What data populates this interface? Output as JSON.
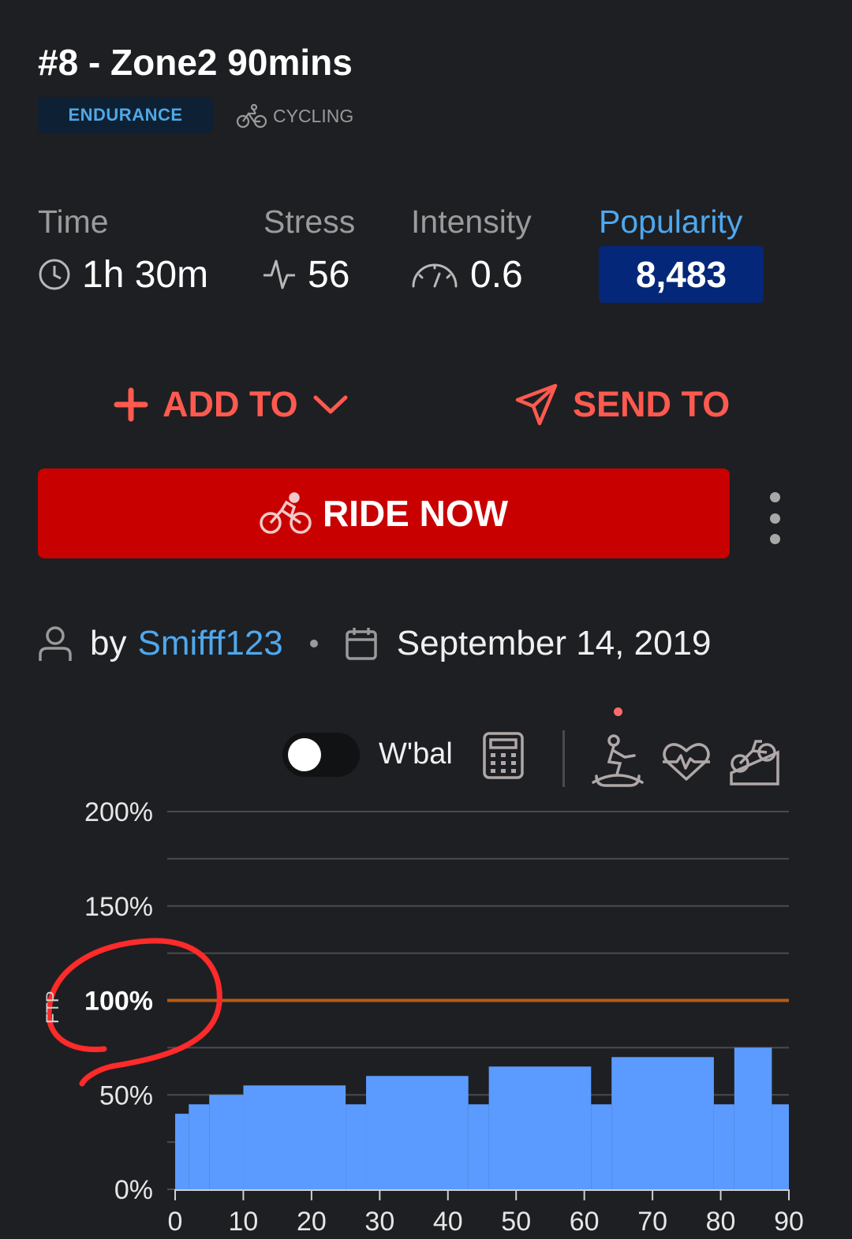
{
  "workout": {
    "title": "#8 - Zone2 90mins",
    "category_badge": "ENDURANCE",
    "sport": "CYCLING"
  },
  "stats": {
    "time": {
      "label": "Time",
      "value": "1h 30m",
      "icon": "clock-icon"
    },
    "stress": {
      "label": "Stress",
      "value": "56",
      "icon": "pulse-icon"
    },
    "intensity": {
      "label": "Intensity",
      "value": "0.6",
      "icon": "gauge-icon"
    },
    "popularity": {
      "label": "Popularity",
      "value": "8,483"
    }
  },
  "actions": {
    "add_to": "ADD TO",
    "send_to": "SEND TO",
    "ride_now": "RIDE NOW"
  },
  "meta": {
    "by": "by",
    "author": "Smifff123",
    "date": "September 14, 2019"
  },
  "chart_controls": {
    "wbal_label": "W'bal",
    "wbal_enabled": false,
    "icons": [
      "calculator-icon",
      "indoor-cyclist-icon",
      "heart-rate-icon",
      "bike-climb-icon"
    ]
  },
  "colors": {
    "accent_red": "#ff5a4f",
    "ride_button": "#c90000",
    "link_blue": "#4ea8ee",
    "popularity_bg": "#04277a",
    "bar_blue": "#5b9bff",
    "ftp_line": "#b85c12",
    "annotation_red": "#ff2a2a"
  },
  "chart_data": {
    "type": "bar",
    "xlabel": "",
    "ylabel": "FTP",
    "xlim": [
      0,
      90
    ],
    "ylim": [
      0,
      200
    ],
    "x_ticks": [
      "0",
      "10",
      "20",
      "30",
      "40",
      "50",
      "60",
      "70",
      "80",
      "90"
    ],
    "y_ticks": [
      "0%",
      "50%",
      "100%",
      "150%",
      "200%"
    ],
    "reference_line": {
      "y": 100,
      "label": "100%"
    },
    "grid": true,
    "segments": [
      {
        "start": 0,
        "end": 2,
        "value": 40
      },
      {
        "start": 2,
        "end": 5,
        "value": 45
      },
      {
        "start": 5,
        "end": 10,
        "value": 50
      },
      {
        "start": 10,
        "end": 25,
        "value": 55
      },
      {
        "start": 25,
        "end": 28,
        "value": 45
      },
      {
        "start": 28,
        "end": 43,
        "value": 60
      },
      {
        "start": 43,
        "end": 46,
        "value": 45
      },
      {
        "start": 46,
        "end": 61,
        "value": 65
      },
      {
        "start": 61,
        "end": 64,
        "value": 45
      },
      {
        "start": 64,
        "end": 79,
        "value": 70
      },
      {
        "start": 79,
        "end": 82,
        "value": 45
      },
      {
        "start": 82,
        "end": 87.5,
        "value": 75
      },
      {
        "start": 87.5,
        "end": 90,
        "value": 45
      }
    ]
  }
}
